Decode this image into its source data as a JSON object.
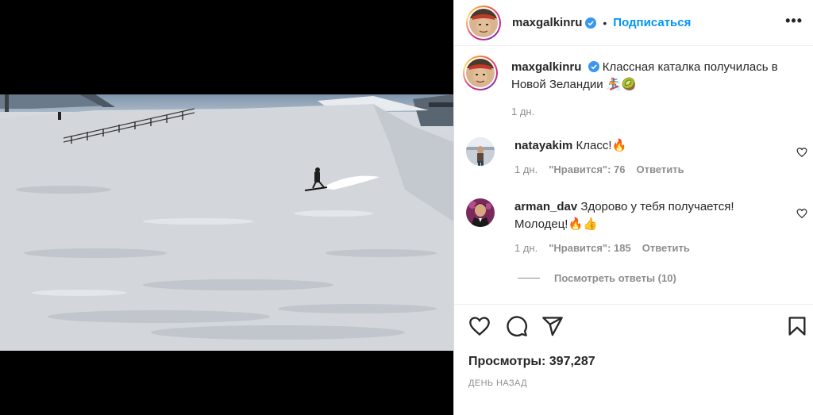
{
  "post": {
    "username": "maxgalkinru",
    "follow_label": "Подписаться",
    "more_label": "•••",
    "separator": "•"
  },
  "caption": {
    "username": "maxgalkinru",
    "text": "Классная каталка получилась в Новой Зеландии 🏂🥝",
    "time": "1 дн."
  },
  "comments": [
    {
      "username": "natayakim",
      "text": "Класс!🔥",
      "time": "1 дн.",
      "likes": "\"Нравится\": 76",
      "reply_label": "Ответить"
    },
    {
      "username": "arman_dav",
      "text": "Здорово у тебя получается! Молодец!🔥👍",
      "time": "1 дн.",
      "likes": "\"Нравится\": 185",
      "reply_label": "Ответить"
    }
  ],
  "view_replies": "Посмотреть ответы (10)",
  "stats": {
    "views": "Просмотры: 397,287",
    "date": "ДЕНЬ НАЗАД"
  },
  "colors": {
    "accent": "#0095f6",
    "verified": "#3897f0",
    "muted": "#8e8e8e"
  }
}
